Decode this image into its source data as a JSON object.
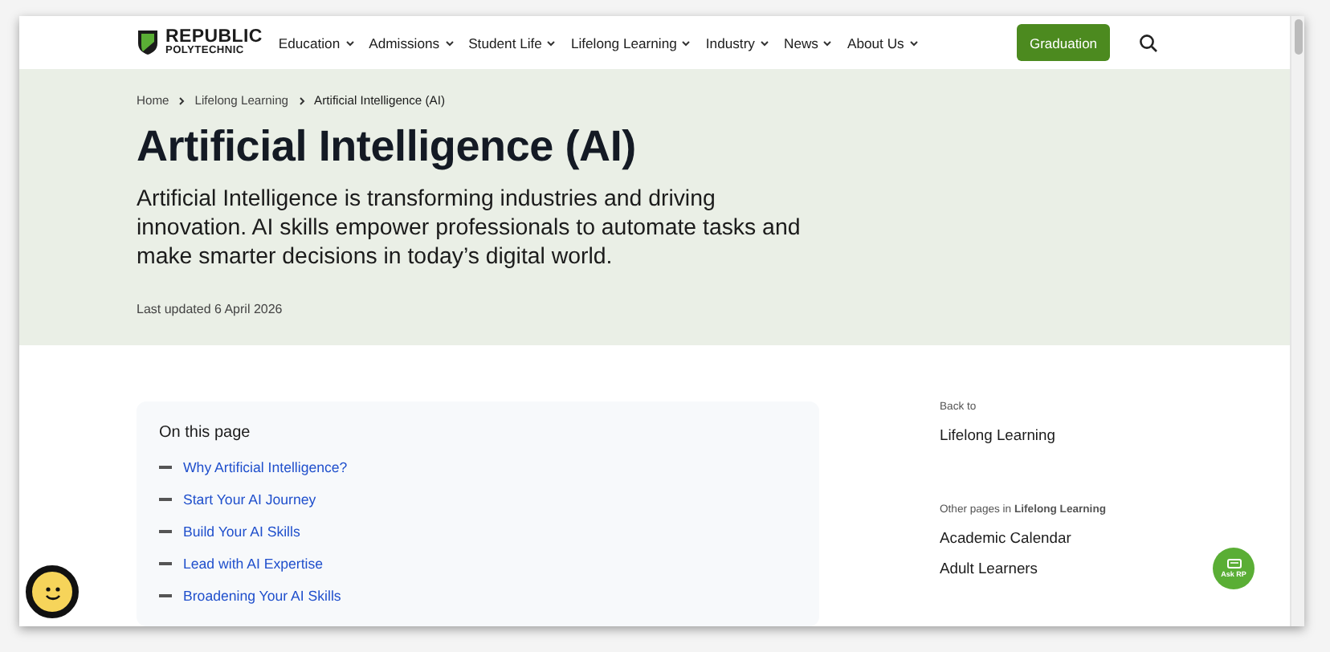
{
  "header": {
    "logo": {
      "line1": "REPUBLIC",
      "line2": "POLYTECHNIC"
    },
    "nav": [
      {
        "label": "Education"
      },
      {
        "label": "Admissions"
      },
      {
        "label": "Student Life"
      },
      {
        "label": "Lifelong Learning"
      },
      {
        "label": "Industry"
      },
      {
        "label": "News"
      },
      {
        "label": "About Us"
      }
    ],
    "cta": "Graduation"
  },
  "breadcrumb": [
    "Home",
    "Lifelong Learning",
    "Artificial Intelligence (AI)"
  ],
  "hero": {
    "title": "Artificial Intelligence (AI)",
    "intro": "Artificial Intelligence is transforming industries and driving innovation. AI skills empower professionals to automate tasks and make smarter decisions in today’s digital world.",
    "updated": "Last updated 6 April 2026"
  },
  "toc": {
    "heading": "On this page",
    "items": [
      "Why Artificial Intelligence?",
      "Start Your AI Journey",
      "Build Your AI Skills",
      "Lead with AI Expertise",
      "Broadening Your AI Skills"
    ]
  },
  "sidebar": {
    "back_label": "Back to",
    "back_link": "Lifelong Learning",
    "other_label": "Other pages in **Lifelong Learning**",
    "pages": [
      "Academic Calendar",
      "Adult Learners"
    ]
  },
  "chat": {
    "label": "Ask RP"
  }
}
